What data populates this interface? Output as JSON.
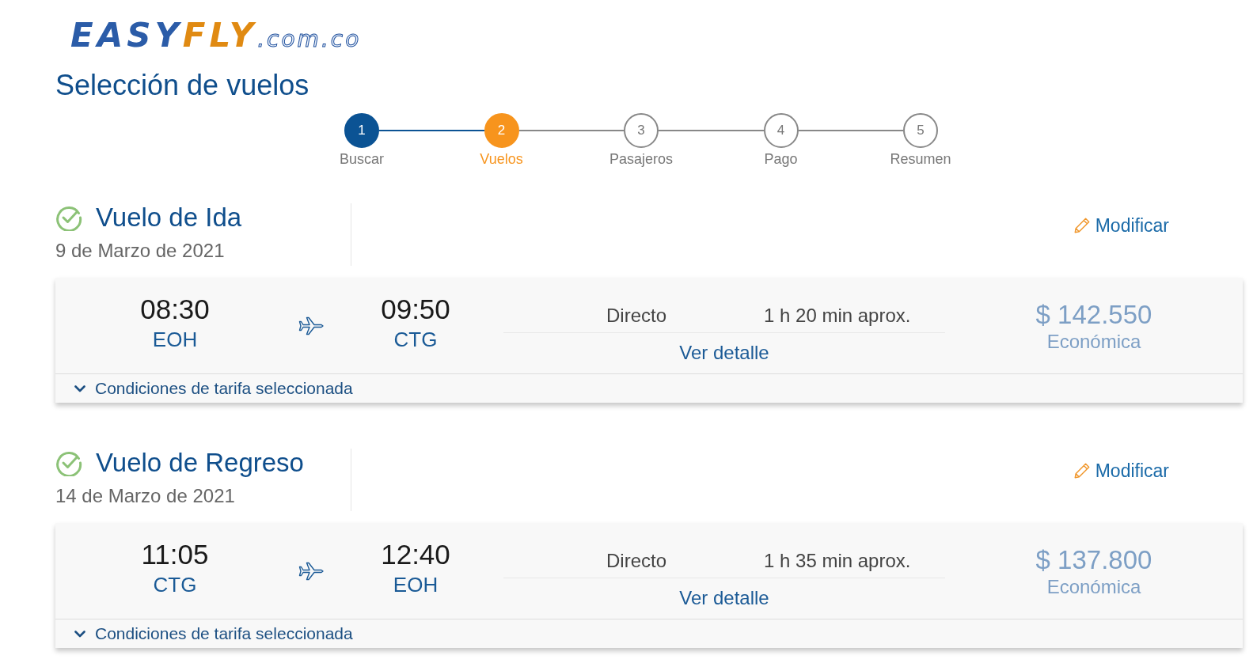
{
  "logo": {
    "part_1": "EASY",
    "part_2": "FLY",
    "domain": ".com.co"
  },
  "page_title": "Selección de vuelos",
  "steps": [
    {
      "number": "1",
      "label": "Buscar",
      "completed": true,
      "selected": false
    },
    {
      "number": "2",
      "label": "Vuelos",
      "completed": false,
      "selected": true
    },
    {
      "number": "3",
      "label": "Pasajeros",
      "completed": false,
      "selected": false
    },
    {
      "number": "4",
      "label": "Pago",
      "completed": false,
      "selected": false
    },
    {
      "number": "5",
      "label": "Resumen",
      "completed": false,
      "selected": false
    }
  ],
  "flights": [
    {
      "title": "Vuelo de Ida",
      "date": "9 de Marzo de 2021",
      "modify_label": "Modificar",
      "departure_time": "08:30",
      "origin": "EOH",
      "arrival_time": "09:50",
      "destination": "CTG",
      "stops": "Directo",
      "duration": "1 h 20 min aprox.",
      "details_link": "Ver detalle",
      "price": "$ 142.550",
      "fare": "Económica",
      "conditions_label": "Condiciones de tarifa seleccionada",
      "conditions_expanded": false
    },
    {
      "title": "Vuelo de Regreso",
      "date": "14 de Marzo de 2021",
      "modify_label": "Modificar",
      "departure_time": "11:05",
      "origin": "CTG",
      "arrival_time": "12:40",
      "destination": "EOH",
      "stops": "Directo",
      "duration": "1 h 35 min aprox.",
      "details_link": "Ver detalle",
      "price": "$ 137.800",
      "fare": "Económica",
      "conditions_label": "Condiciones de tarifa seleccionada",
      "conditions_expanded": false
    }
  ]
}
